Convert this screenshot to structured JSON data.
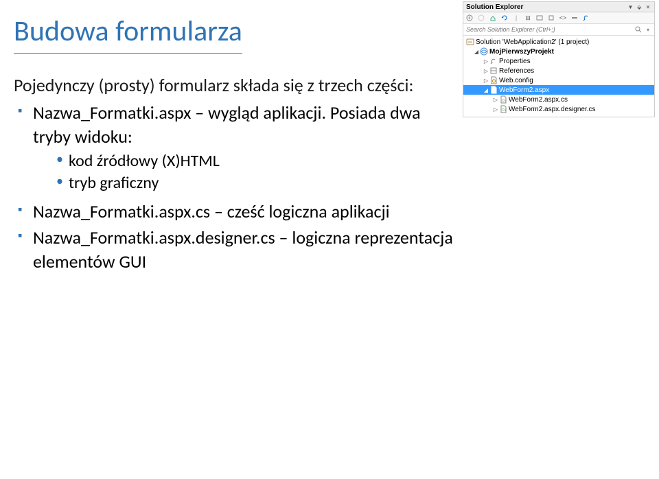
{
  "slide": {
    "title": "Budowa formularza",
    "intro": "Pojedynczy (prosty) formularz składa się z trzech części:",
    "items": [
      {
        "text": "Nazwa_Formatki.aspx – wygląd aplikacji. Posiada dwa tryby widoku:",
        "sub": [
          "kod źródłowy (X)HTML",
          "tryb graficzny"
        ]
      },
      {
        "text": "Nazwa_Formatki.aspx.cs – cześć logiczna aplikacji"
      },
      {
        "text": "Nazwa_Formatki.aspx.designer.cs – logiczna reprezentacja elementów GUI"
      }
    ]
  },
  "solExp": {
    "title": "Solution Explorer",
    "searchPlaceholder": "Search Solution Explorer (Ctrl+;)",
    "tree": {
      "solution": "Solution 'WebApplication2' (1 project)",
      "project": "MojPierwszyProjekt",
      "nodes": [
        "Properties",
        "References",
        "Web.config"
      ],
      "selected": "WebForm2.aspx",
      "children": [
        "WebForm2.aspx.cs",
        "WebForm2.aspx.designer.cs"
      ]
    },
    "titleIcons": {
      "dropdown": "▼",
      "pin": "📌",
      "close": "✕"
    }
  }
}
